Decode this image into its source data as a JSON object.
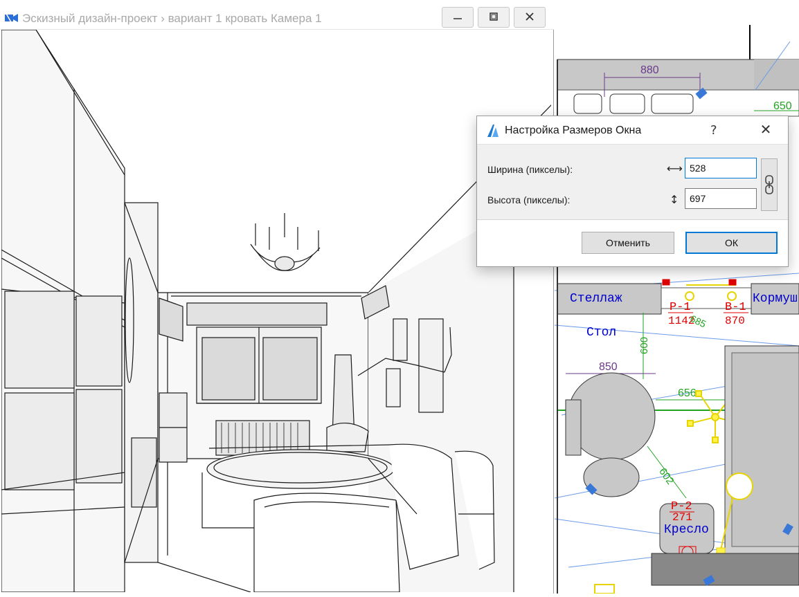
{
  "camera_window": {
    "title": "Эскизный дизайн-проект › вариант 1 кровать Камера 1",
    "icons": {
      "app": "camera-icon",
      "minimize": "minimize-icon",
      "maximize": "maximize-icon",
      "close": "close-icon"
    }
  },
  "floor_plan": {
    "dimensions": {
      "d880": "880",
      "d650": "650",
      "d600": "600",
      "d850": "850",
      "d656": "656",
      "d602": "602",
      "d685": "685"
    },
    "labels": {
      "stellazh": "Стеллаж",
      "kormush": "Кормуш",
      "stol": "Стол",
      "kreslo": "Кресло"
    },
    "tags": {
      "p1_code": "Р-1",
      "p1_value": "1142",
      "b1_code": "В-1",
      "b1_value": "870",
      "p2_code": "Р-2",
      "p2_value": "271"
    },
    "colors": {
      "dimension": "#6a3a8a",
      "green_dim": "#22a322",
      "tag_red": "#e00000",
      "label_blue": "#0000cc",
      "furniture_gray": "#c8c8c8"
    }
  },
  "dialog": {
    "title": "Настройка Размеров Окна",
    "help": "?",
    "close": "✕",
    "width_label": "Ширина (пикселы):",
    "height_label": "Высота (пикселы):",
    "width_value": "528",
    "height_value": "697",
    "cancel_label": "Отменить",
    "ok_label": "ОК",
    "icons": {
      "logo": "archicad-logo-icon",
      "width_arrow": "horizontal-arrow-icon",
      "height_arrow": "vertical-arrow-icon",
      "link": "chain-link-icon"
    }
  }
}
